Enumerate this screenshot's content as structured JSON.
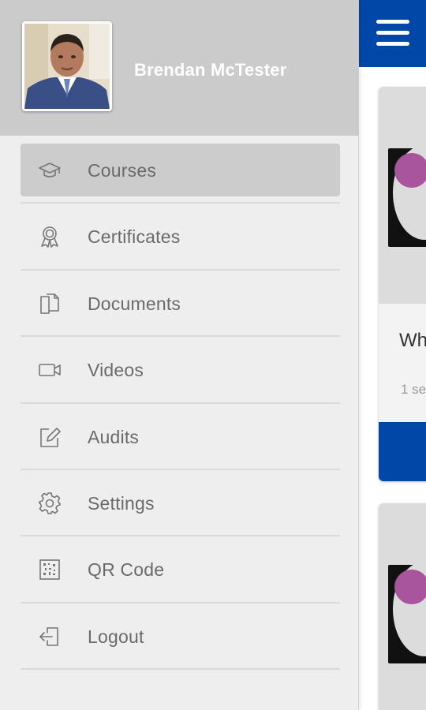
{
  "user": {
    "name": "Brendan McTester"
  },
  "menu": {
    "items": [
      {
        "label": "Courses",
        "icon": "graduation-cap-icon",
        "active": true
      },
      {
        "label": "Certificates",
        "icon": "award-ribbon-icon",
        "active": false
      },
      {
        "label": "Documents",
        "icon": "documents-icon",
        "active": false
      },
      {
        "label": "Videos",
        "icon": "video-camera-icon",
        "active": false
      },
      {
        "label": "Audits",
        "icon": "edit-icon",
        "active": false
      },
      {
        "label": "Settings",
        "icon": "gear-icon",
        "active": false
      },
      {
        "label": "QR Code",
        "icon": "qr-code-icon",
        "active": false
      },
      {
        "label": "Logout",
        "icon": "logout-icon",
        "active": false
      }
    ]
  },
  "courses": [
    {
      "title_partial": "Wh",
      "meta_partial": "1 se"
    },
    {
      "title_partial": "",
      "meta_partial": ""
    }
  ],
  "colors": {
    "brand_blue": "#0047a8",
    "logo_purple": "#a8559e",
    "drawer_bg": "#eeeeee",
    "drawer_header_bg": "#cbcbcb",
    "active_item_bg": "#cccccc",
    "menu_text": "#6a6a6a"
  }
}
